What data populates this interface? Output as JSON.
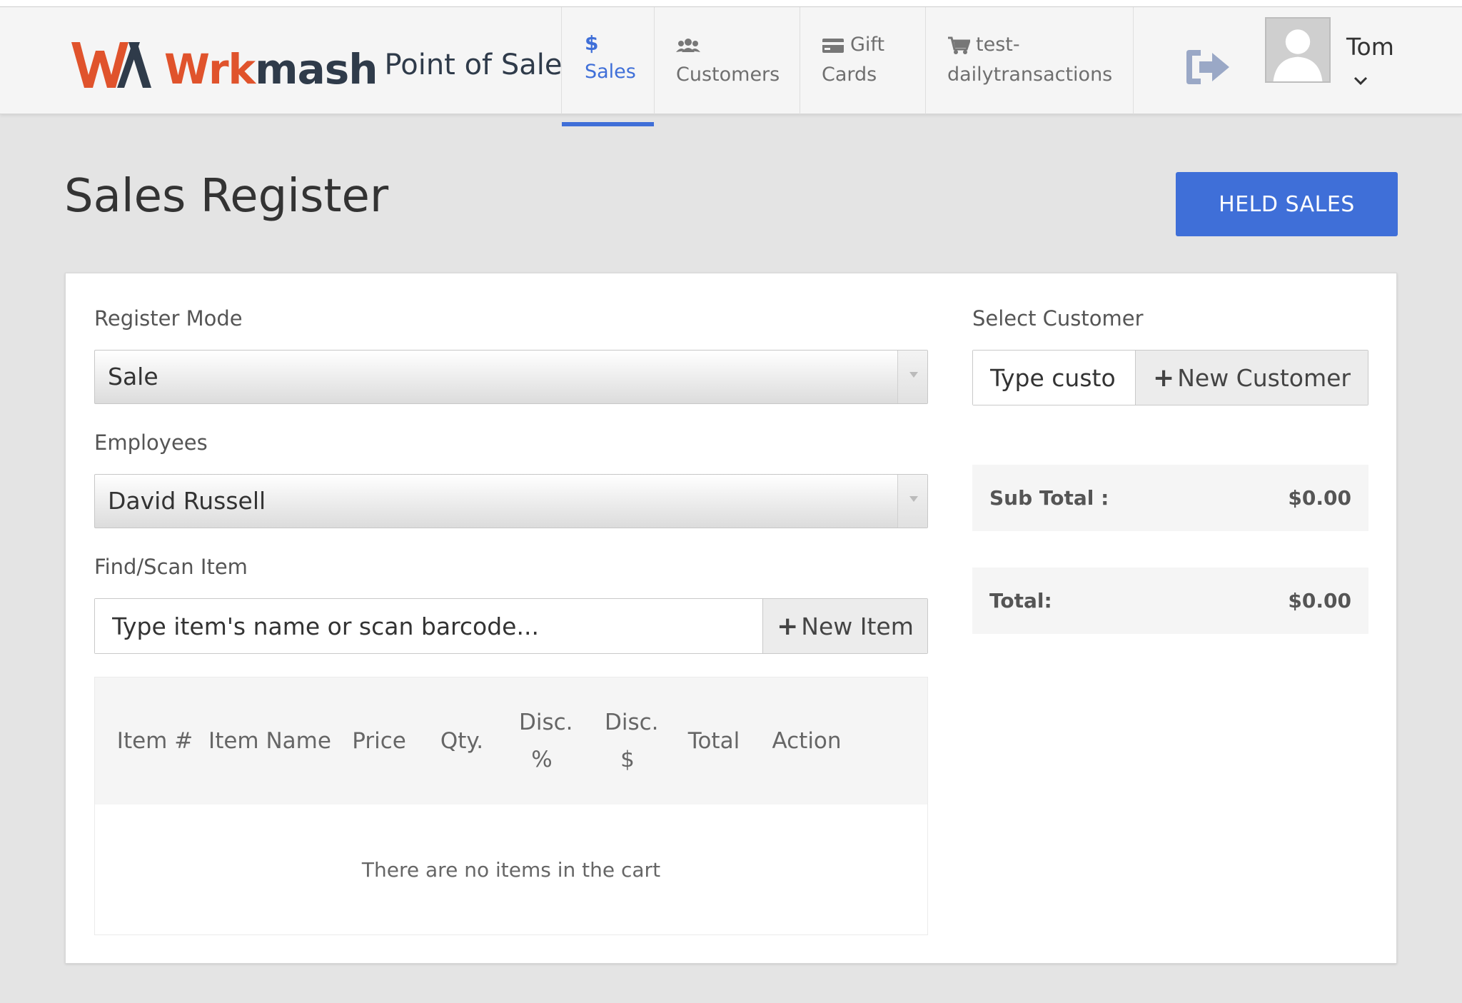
{
  "brand": {
    "logo_text_a": "Wrk",
    "logo_text_b": "mash",
    "app_name": "Point of Sale",
    "colors": {
      "logo_orange": "#e0532c",
      "logo_dark": "#2f3b4a",
      "accent": "#3f6fd8"
    }
  },
  "nav": {
    "items": [
      {
        "label": "Sales",
        "icon": "dollar-icon",
        "active": true
      },
      {
        "label_line1": "Customers",
        "icon": "users-icon",
        "active": false
      },
      {
        "label_line1": "Gift",
        "label_line2": "Cards",
        "icon": "credit-card-icon",
        "active": false
      },
      {
        "label_line1": "test-",
        "label_line2": "dailytransactions",
        "icon": "cart-icon",
        "active": false
      }
    ]
  },
  "user": {
    "name": "Tom",
    "icons": [
      "logout-icon",
      "avatar",
      "chevron-down-icon"
    ]
  },
  "page": {
    "title": "Sales Register",
    "held_sales_label": "HELD SALES"
  },
  "register": {
    "mode_label": "Register Mode",
    "mode_value": "Sale",
    "employees_label": "Employees",
    "employee_value": "David Russell",
    "find_label": "Find/Scan Item",
    "find_placeholder": "Type item's name or scan barcode...",
    "new_item_label": "New Item"
  },
  "cart": {
    "columns": [
      "Item #",
      "Item Name",
      "Price",
      "Qty.",
      "Disc. %",
      "Disc. $",
      "Total",
      "Action"
    ],
    "empty_message": "There are no items in the cart"
  },
  "customer": {
    "label": "Select Customer",
    "input_value": "Type custo",
    "new_customer_label": "New Customer"
  },
  "totals": {
    "subtotal_label": "Sub Total :",
    "subtotal_value": "$0.00",
    "total_label": "Total:",
    "total_value": "$0.00"
  }
}
